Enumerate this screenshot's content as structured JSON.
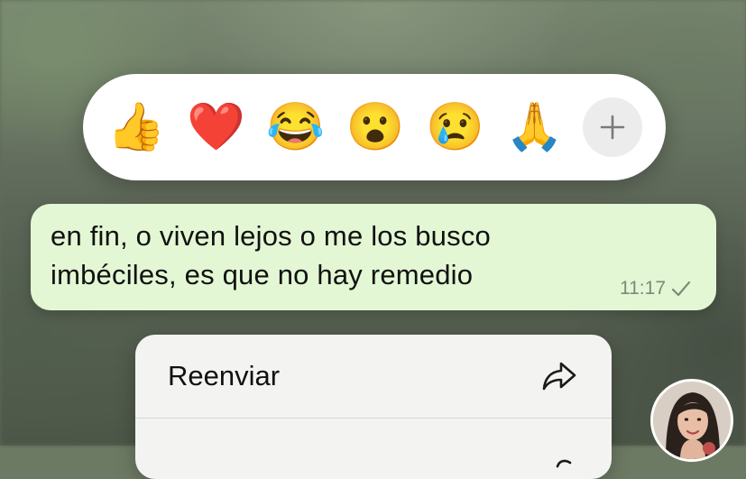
{
  "reactions": [
    {
      "name": "thumbs-up",
      "glyph": "👍"
    },
    {
      "name": "red-heart",
      "glyph": "❤️"
    },
    {
      "name": "tears-of-joy",
      "glyph": "😂"
    },
    {
      "name": "surprised",
      "glyph": "😮"
    },
    {
      "name": "crying",
      "glyph": "😢"
    },
    {
      "name": "folded-hands",
      "glyph": "🙏"
    }
  ],
  "add_reaction_icon": "plus-icon",
  "message": {
    "line1": "en fin, o viven lejos o me los busco",
    "line2": "imbéciles, es que no hay remedio",
    "time": "11:17",
    "status_icon": "single-check-icon"
  },
  "menu": {
    "items": [
      {
        "label": "Reenviar",
        "icon": "forward-arrow-icon"
      },
      {
        "label": "",
        "icon": "partial-icon"
      }
    ]
  },
  "colors": {
    "bubble": "#e3f7d4",
    "reaction_bar": "#ffffff",
    "menu": "#f3f3f1",
    "timestamp": "#7c8a78"
  }
}
